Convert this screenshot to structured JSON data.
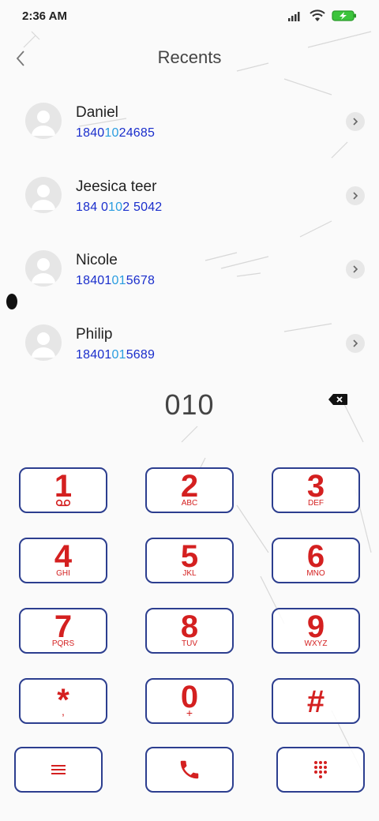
{
  "status": {
    "time": "2:36 AM",
    "icons": [
      "signal-icon",
      "wifi-icon",
      "battery-charging-icon"
    ],
    "battery_color": "#3cc43c"
  },
  "header": {
    "title": "Recents",
    "back_icon": "chevron-left-icon"
  },
  "contacts": [
    {
      "name": "Daniel",
      "number_pre": "1840",
      "number_hl": "10",
      "number_post": "24685"
    },
    {
      "name": "Jeesica teer",
      "number_pre": "184 0",
      "number_hl": "10",
      "number_post": "2 5042"
    },
    {
      "name": "Nicole",
      "number_pre": "18401",
      "number_hl": "01",
      "number_post": "5678"
    },
    {
      "name": "Philip",
      "number_pre": "18401",
      "number_hl": "01",
      "number_post": "5689"
    }
  ],
  "dialer": {
    "dialed": "010",
    "backspace_icon": "backspace-icon"
  },
  "keypad": {
    "keys": [
      {
        "digit": "1",
        "letters": ""
      },
      {
        "digit": "2",
        "letters": "ABC"
      },
      {
        "digit": "3",
        "letters": "DEF"
      },
      {
        "digit": "4",
        "letters": "GHI"
      },
      {
        "digit": "5",
        "letters": "JKL"
      },
      {
        "digit": "6",
        "letters": "MNO"
      },
      {
        "digit": "7",
        "letters": "PQRS"
      },
      {
        "digit": "8",
        "letters": "TUV"
      },
      {
        "digit": "9",
        "letters": "WXYZ"
      },
      {
        "digit": "*",
        "letters": ","
      },
      {
        "digit": "0",
        "letters": "+"
      },
      {
        "digit": "#",
        "letters": ""
      }
    ],
    "actions": [
      "menu-icon",
      "phone-icon",
      "keypad-icon"
    ]
  },
  "colors": {
    "accent_red": "#d42020",
    "key_border": "#2c3e8f",
    "number_blue": "#1a2ecc",
    "number_highlight": "#2a9de0"
  }
}
